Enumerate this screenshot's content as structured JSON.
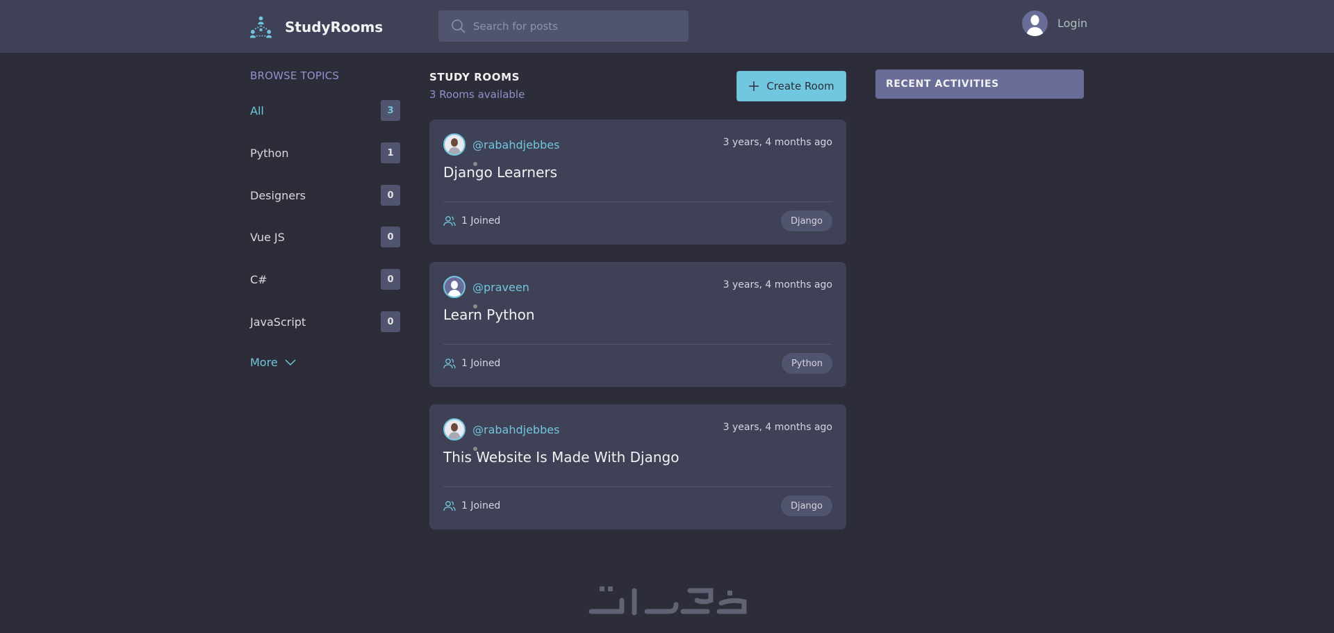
{
  "header": {
    "app_name": "StudyRooms",
    "search_placeholder": "Search for posts",
    "login_label": "Login"
  },
  "sidebar": {
    "title": "BROWSE TOPICS",
    "topics": [
      {
        "label": "All",
        "count": "3",
        "active": true
      },
      {
        "label": "Python",
        "count": "1"
      },
      {
        "label": "Designers",
        "count": "0"
      },
      {
        "label": "Vue JS",
        "count": "0"
      },
      {
        "label": "C#",
        "count": "0"
      },
      {
        "label": "JavaScript",
        "count": "0"
      }
    ],
    "more_label": "More"
  },
  "main": {
    "title": "STUDY ROOMS",
    "subtitle": "3 Rooms available",
    "create_label": "Create Room",
    "rooms": [
      {
        "user": "@rabahdjebbes",
        "time": "3 years, 4 months ago",
        "title": "Django Learners",
        "joined": "1 Joined",
        "tag": "Django"
      },
      {
        "user": "@praveen",
        "time": "3 years, 4 months ago",
        "title": "Learn Python",
        "joined": "1 Joined",
        "tag": "Python"
      },
      {
        "user": "@rabahdjebbes",
        "time": "3 years, 4 months ago",
        "title": "This Website Is Made With Django",
        "joined": "1 Joined",
        "tag": "Django"
      }
    ]
  },
  "activity": {
    "title": "RECENT ACTIVITIES"
  },
  "colors": {
    "background": "#2d2d39",
    "header": "#3f4156",
    "accent": "#71c6dd",
    "card": "#3f4156",
    "muted_purple": "#696d97"
  },
  "watermark_text": "خمسات"
}
